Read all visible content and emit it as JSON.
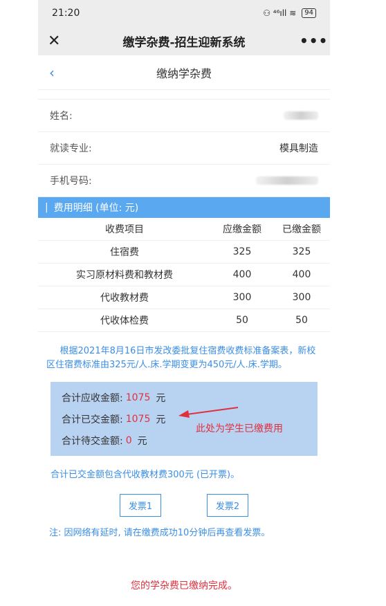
{
  "statusbar": {
    "time": "21:20",
    "signal": "⚇ ⁴⁶ıll ≋",
    "battery": "94"
  },
  "wechat": {
    "title": "缴学杂费-招生迎新系统",
    "close_icon": "close-icon",
    "more_icon": "more-icon"
  },
  "page": {
    "title": "缴纳学杂费",
    "back_icon": "chevron-left-icon"
  },
  "info": [
    {
      "label": "姓名:",
      "value": ""
    },
    {
      "label": "就读专业:",
      "value": "模具制造"
    },
    {
      "label": "手机号码:",
      "value": ""
    }
  ],
  "fee_section": {
    "title": "费用明细 (单位: 元)"
  },
  "fee_table": {
    "headers": [
      "收费项目",
      "应缴金额",
      "已缴金额"
    ],
    "rows": [
      [
        "住宿费",
        "325",
        "325"
      ],
      [
        "实习原材料费和教材费",
        "400",
        "400"
      ],
      [
        "代收教材费",
        "300",
        "300"
      ],
      [
        "代收体检费",
        "50",
        "50"
      ]
    ]
  },
  "notice": "根据2021年8月16日市发改委批复住宿费收费标准备案表，新校区住宿费标准由325元/人.床.学期变更为450元/人.床.学期。",
  "summary": {
    "due_label": "合计应收金额:",
    "due_amount": "1075",
    "due_unit": "元",
    "paid_label": "合计已交金额:",
    "paid_amount": "1075",
    "paid_unit": "元",
    "pending_label": "合计待交金额:",
    "pending_amount": "0",
    "pending_unit": "元"
  },
  "annotation": "此处为学生已缴费用",
  "colors": {
    "accent": "#3a8ee6",
    "section_bar": "#5aa9f0",
    "summary_bg": "#b8d2f2",
    "alert": "#e0303e"
  },
  "paid_note": "合计已交金额包含代收教材费300元 (已开票)。",
  "buttons": {
    "invoice1": "发票1",
    "invoice2": "发票2"
  },
  "delay_note": "注: 因网络有延时, 请在缴费成功10分钟后再查看发票。",
  "completion": "您的学杂费已缴纳完成。"
}
